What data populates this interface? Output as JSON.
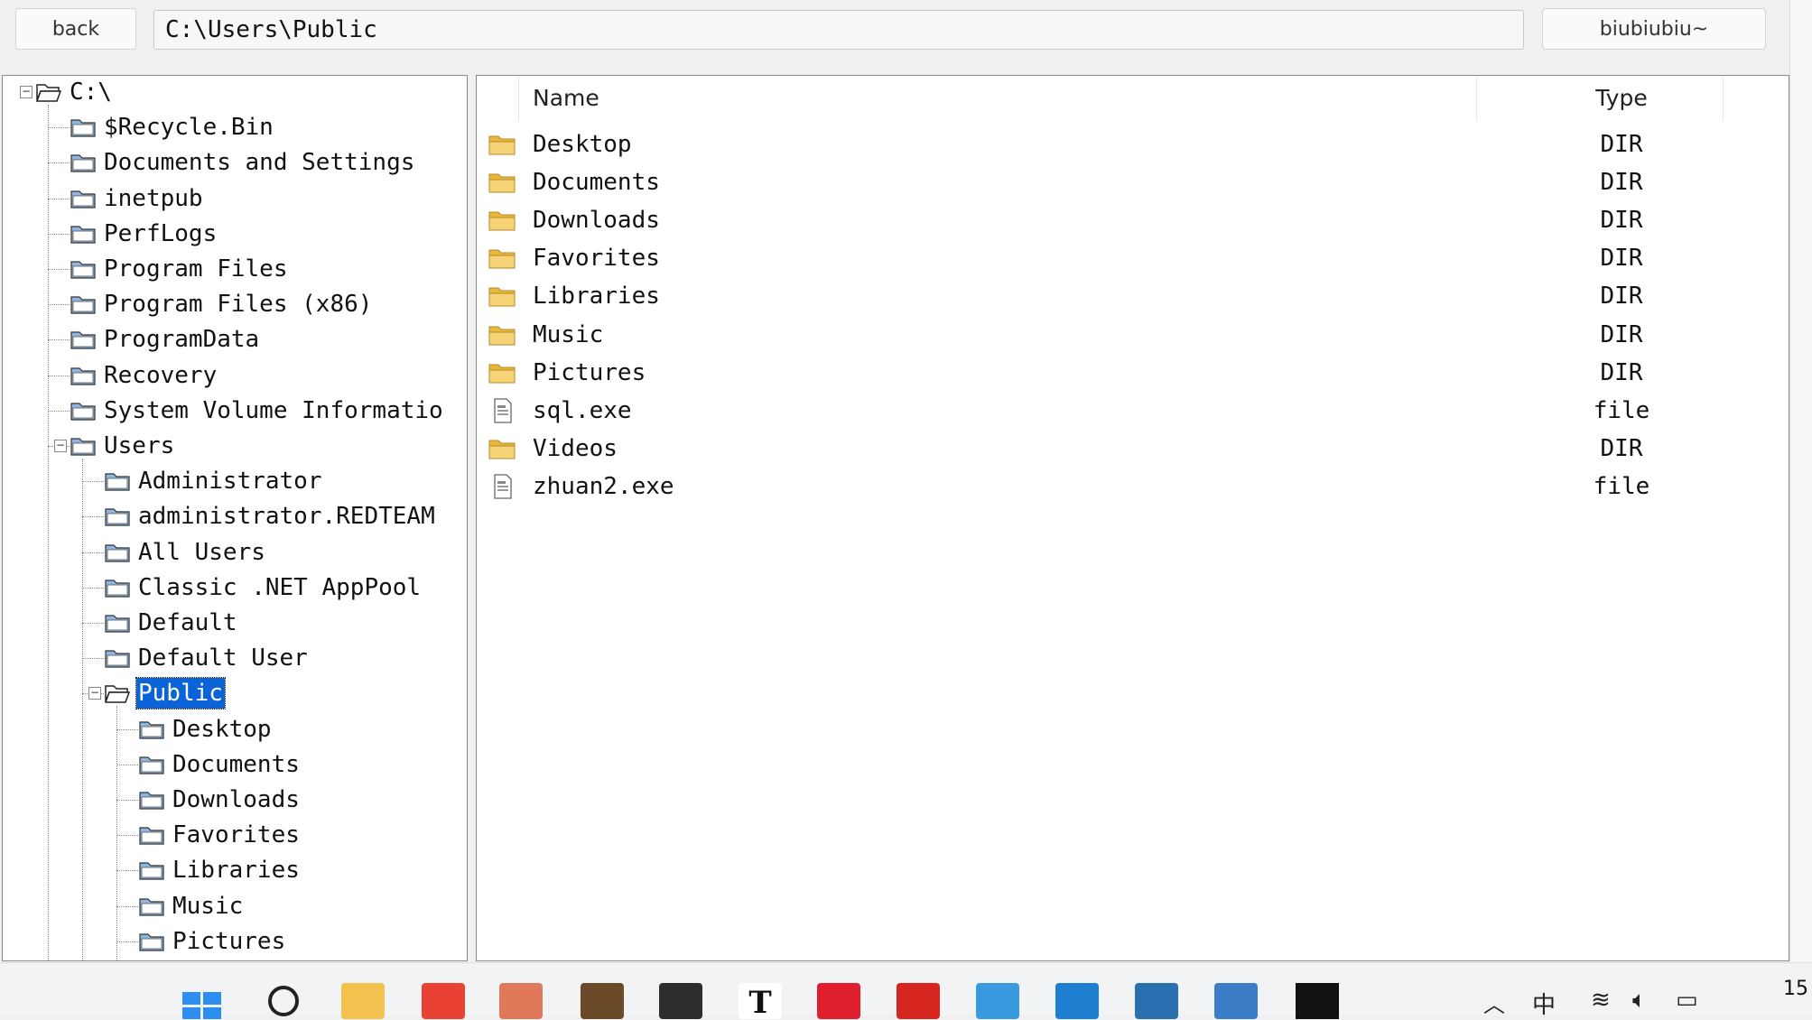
{
  "toolbar": {
    "back_label": "back",
    "path_value": "C:\\Users\\Public",
    "extra_label": "biubiubiu~"
  },
  "tree": {
    "items": [
      {
        "label": "C:\\",
        "depth": 0,
        "open": true,
        "expander": "minus"
      },
      {
        "label": "$Recycle.Bin",
        "depth": 1
      },
      {
        "label": "Documents and Settings",
        "depth": 1
      },
      {
        "label": "inetpub",
        "depth": 1
      },
      {
        "label": "PerfLogs",
        "depth": 1
      },
      {
        "label": "Program Files",
        "depth": 1
      },
      {
        "label": "Program Files (x86)",
        "depth": 1
      },
      {
        "label": "ProgramData",
        "depth": 1
      },
      {
        "label": "Recovery",
        "depth": 1
      },
      {
        "label": "System Volume Informatio",
        "depth": 1
      },
      {
        "label": "Users",
        "depth": 1,
        "expander": "minus"
      },
      {
        "label": "Administrator",
        "depth": 2
      },
      {
        "label": "administrator.REDTEAM",
        "depth": 2
      },
      {
        "label": "All Users",
        "depth": 2
      },
      {
        "label": "Classic .NET AppPool",
        "depth": 2
      },
      {
        "label": "Default",
        "depth": 2
      },
      {
        "label": "Default User",
        "depth": 2
      },
      {
        "label": "Public",
        "depth": 2,
        "open": true,
        "selected": true,
        "expander": "minus"
      },
      {
        "label": "Desktop",
        "depth": 3
      },
      {
        "label": "Documents",
        "depth": 3
      },
      {
        "label": "Downloads",
        "depth": 3
      },
      {
        "label": "Favorites",
        "depth": 3
      },
      {
        "label": "Libraries",
        "depth": 3
      },
      {
        "label": "Music",
        "depth": 3
      },
      {
        "label": "Pictures",
        "depth": 3
      }
    ]
  },
  "list": {
    "columns": {
      "name": "Name",
      "type": "Type"
    },
    "rows": [
      {
        "name": "Desktop",
        "type": "DIR",
        "icon": "folder-icon"
      },
      {
        "name": "Documents",
        "type": "DIR",
        "icon": "folder-icon"
      },
      {
        "name": "Downloads",
        "type": "DIR",
        "icon": "folder-icon"
      },
      {
        "name": "Favorites",
        "type": "DIR",
        "icon": "folder-icon"
      },
      {
        "name": "Libraries",
        "type": "DIR",
        "icon": "folder-icon"
      },
      {
        "name": "Music",
        "type": "DIR",
        "icon": "folder-icon"
      },
      {
        "name": "Pictures",
        "type": "DIR",
        "icon": "folder-icon"
      },
      {
        "name": "sql.exe",
        "type": "file",
        "icon": "file-icon"
      },
      {
        "name": "Videos",
        "type": "DIR",
        "icon": "folder-icon"
      },
      {
        "name": "zhuan2.exe",
        "type": "file",
        "icon": "file-icon"
      }
    ]
  },
  "taskbar": {
    "apps": [
      "windows-start-icon",
      "search-icon",
      "file-explorer-icon",
      "chrome-icon",
      "app-colorful-icon",
      "game-icon",
      "terminal-icon",
      "typora-icon",
      "netease-music-icon",
      "app-red-icon",
      "app-blue-icon",
      "vmware-icon",
      "network-lock-icon",
      "remote-desktop-icon",
      "black-app-icon"
    ],
    "ime": "中",
    "clock": "15"
  },
  "colors": {
    "selected": "#0a64d8",
    "folder": "#e8b83a",
    "folder_tree": "#8fb6e0"
  }
}
